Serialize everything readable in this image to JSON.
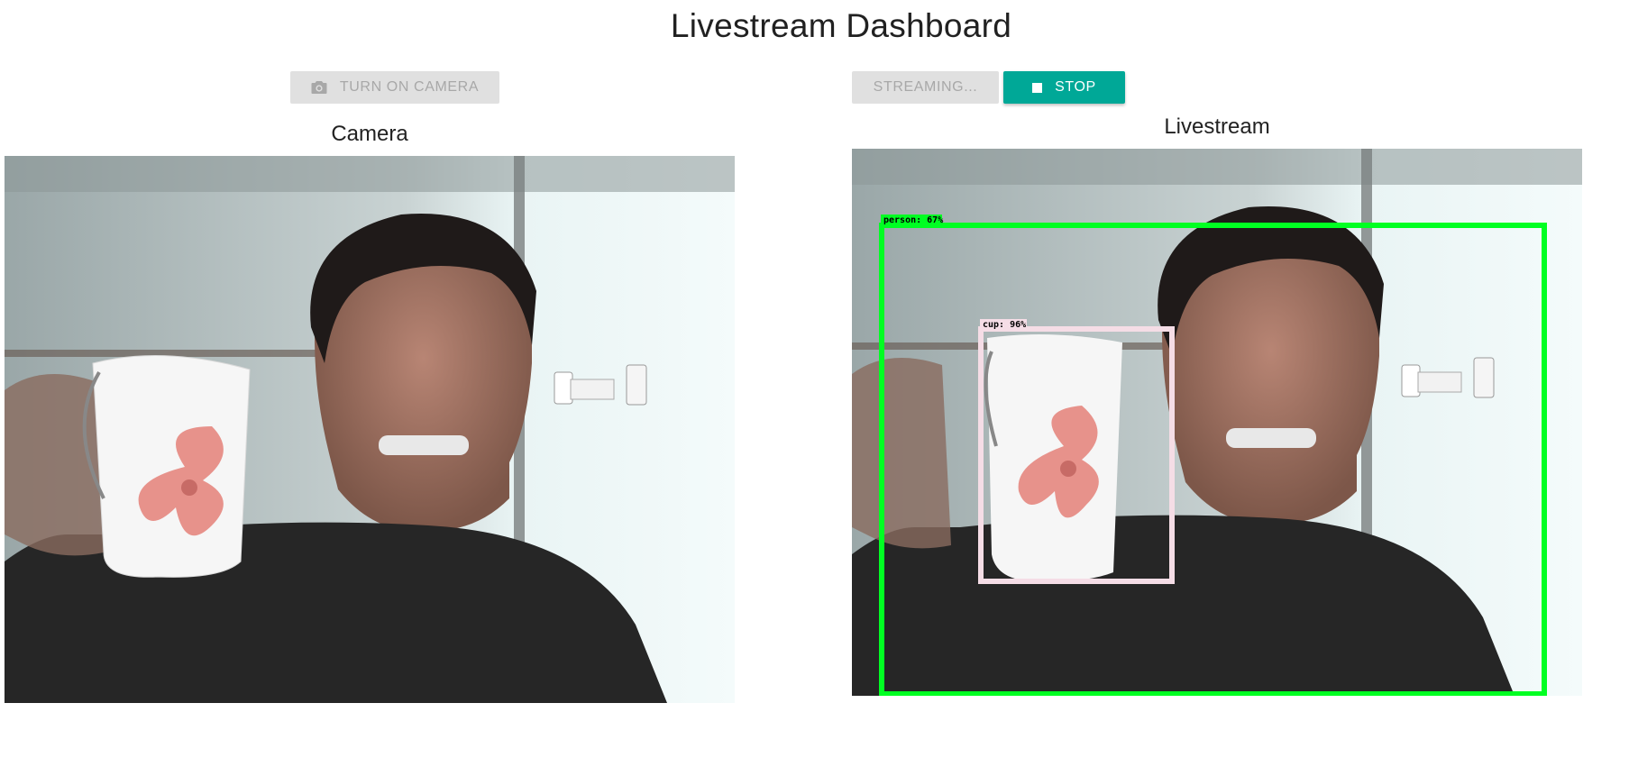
{
  "header": {
    "title": "Livestream Dashboard"
  },
  "controls": {
    "camera_button": {
      "label": "TURN ON CAMERA",
      "icon": "camera-icon",
      "state": "disabled"
    },
    "streaming_button": {
      "label": "STREAMING...",
      "state": "disabled"
    },
    "stop_button": {
      "label": "STOP",
      "icon": "stop-icon",
      "state": "active"
    }
  },
  "panels": {
    "camera": {
      "title": "Camera"
    },
    "livestream": {
      "title": "Livestream"
    }
  },
  "detections": [
    {
      "label": "person: 67%",
      "color": "#00ff22"
    },
    {
      "label": "cup: 96%",
      "color": "#f5dde6"
    }
  ],
  "colors": {
    "accent": "#00a897",
    "disabled_bg": "#e0e0e0",
    "disabled_text": "#a8a8a8"
  }
}
